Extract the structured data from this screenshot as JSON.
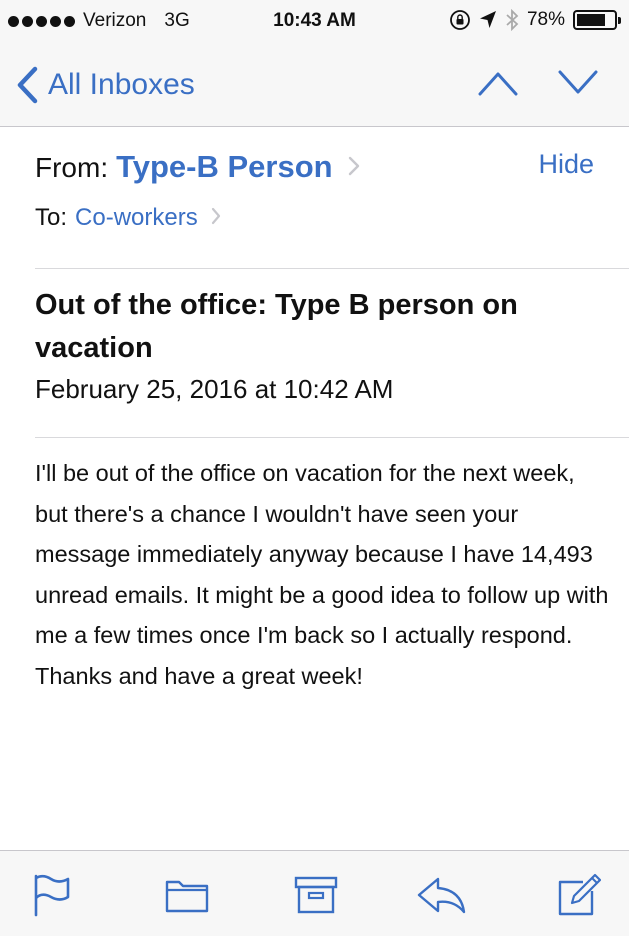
{
  "status_bar": {
    "carrier": "Verizon",
    "network": "3G",
    "time": "10:43 AM",
    "battery": "78%",
    "battery_level": 0.78,
    "icons": [
      "signal-dots-icon",
      "orientation-lock-icon",
      "location-arrow-icon",
      "bluetooth-icon",
      "battery-icon"
    ]
  },
  "nav": {
    "back_label": "All Inboxes",
    "icons": [
      "chevron-left-icon",
      "chevron-up-icon",
      "chevron-down-icon"
    ]
  },
  "header": {
    "from_label": "From:",
    "sender": "Type-B Person",
    "hide_label": "Hide",
    "to_label": "To:",
    "recipient": "Co-workers"
  },
  "message": {
    "subject": "Out of the office: Type B person on vacation",
    "date": "February 25, 2016 at 10:42 AM",
    "body": "I'll be out of the office on vacation for the next week, but there's a chance I wouldn't have seen your message immediately anyway because I have 14,493 unread emails. It might be a good idea to follow up with me a few times once I'm back so I actually respond. Thanks and have a great week!"
  },
  "toolbar": {
    "icons": [
      "flag-icon",
      "folder-icon",
      "archive-icon",
      "reply-icon",
      "compose-icon"
    ]
  },
  "colors": {
    "accent": "#3a6fc4",
    "bar_background": "#f7f7f7",
    "separator": "#d9d9dc",
    "chevron_gray": "#c7c7cc"
  }
}
